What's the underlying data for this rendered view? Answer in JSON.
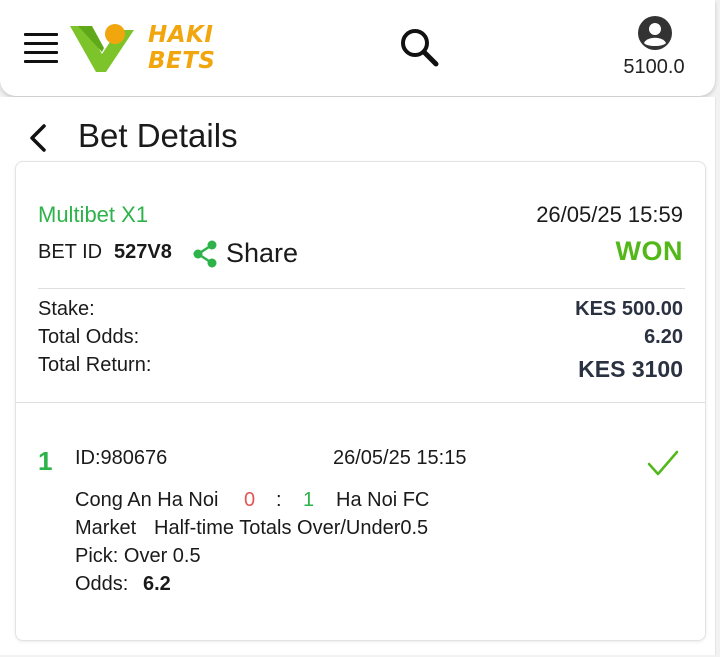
{
  "header": {
    "logo_line1": "HAKI",
    "logo_line2": "BETS",
    "balance": "5100.0",
    "icons": {
      "menu": "hamburger-menu-icon",
      "search": "search-icon",
      "account": "account-circle-icon"
    }
  },
  "page": {
    "title": "Bet Details",
    "back_icon": "chevron-left-icon"
  },
  "bet": {
    "type": "Multibet X1",
    "date": "26/05/25 15:59",
    "id_label": "BET ID",
    "id": "527V8",
    "share_label": "Share",
    "status": "WON",
    "summary": {
      "stake_label": "Stake:",
      "stake": "KES 500.00",
      "odds_label": "Total Odds:",
      "odds": "6.20",
      "return_label": "Total Return:",
      "return": "KES 3100"
    },
    "selections": [
      {
        "number": "1",
        "id": "ID:980676",
        "date": "26/05/25 15:15",
        "home": "Cong An Ha Noi",
        "home_score": "0",
        "separator": ":",
        "away_score": "1",
        "away": "Ha Noi FC",
        "market_label": "Market",
        "market": "Half-time Totals Over/Under0.5",
        "pick": "Pick: Over 0.5",
        "odds_label": "Odds:",
        "odds": "6.2",
        "result_icon": "checkmark-icon"
      }
    ]
  },
  "colors": {
    "brand_green": "#7cc42a",
    "brand_orange": "#f2a60d",
    "accent_green": "#2db34a",
    "won_green": "#52b81a",
    "loss_red": "#e25555",
    "value_dark": "#2a3141"
  }
}
